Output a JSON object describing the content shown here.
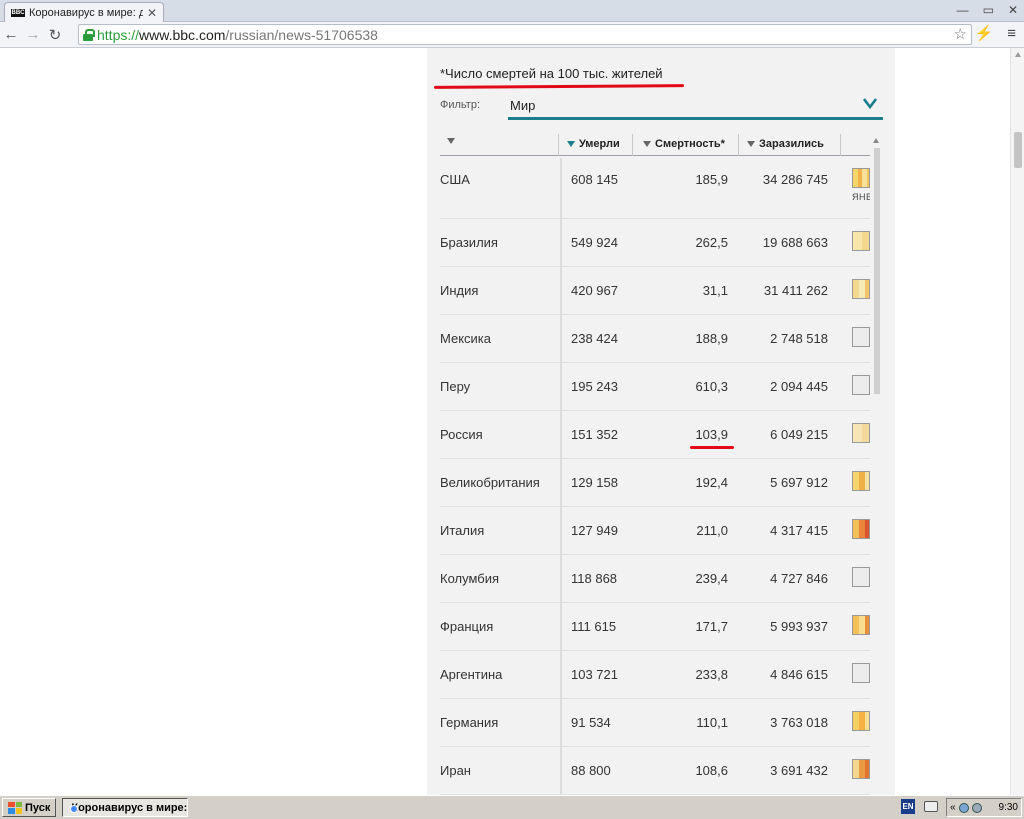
{
  "browser": {
    "tab_title": "Коронавирус в мире: данн",
    "tab_favicon_text": "BBC",
    "url_scheme": "https://",
    "url_host": "www.bbc.com",
    "url_path": "/russian/news-51706538"
  },
  "page": {
    "note": "*Число смертей на 100 тыс. жителей",
    "filter_label": "Фильтр:",
    "filter_value": "Мир"
  },
  "table": {
    "headers": {
      "country": "",
      "deaths": "Умерли",
      "rate": "Смертность*",
      "cases": "Заразились"
    },
    "rows": [
      {
        "country": "США",
        "deaths": "608 145",
        "rate": "185,9",
        "cases": "34 286 745"
      },
      {
        "country": "Бразилия",
        "deaths": "549 924",
        "rate": "262,5",
        "cases": "19 688 663"
      },
      {
        "country": "Индия",
        "deaths": "420 967",
        "rate": "31,1",
        "cases": "31 411 262"
      },
      {
        "country": "Мексика",
        "deaths": "238 424",
        "rate": "188,9",
        "cases": "2 748 518"
      },
      {
        "country": "Перу",
        "deaths": "195 243",
        "rate": "610,3",
        "cases": "2 094 445"
      },
      {
        "country": "Россия",
        "deaths": "151 352",
        "rate": "103,9",
        "cases": "6 049 215"
      },
      {
        "country": "Великобритания",
        "deaths": "129 158",
        "rate": "192,4",
        "cases": "5 697 912"
      },
      {
        "country": "Италия",
        "deaths": "127 949",
        "rate": "211,0",
        "cases": "4 317 415"
      },
      {
        "country": "Колумбия",
        "deaths": "118 868",
        "rate": "239,4",
        "cases": "4 727 846"
      },
      {
        "country": "Франция",
        "deaths": "111 615",
        "rate": "171,7",
        "cases": "5 993 937"
      },
      {
        "country": "Аргентина",
        "deaths": "103 721",
        "rate": "233,8",
        "cases": "4 846 615"
      },
      {
        "country": "Германия",
        "deaths": "91 534",
        "rate": "110,1",
        "cases": "3 763 018"
      },
      {
        "country": "Иран",
        "deaths": "88 800",
        "rate": "108,6",
        "cases": "3 691 432"
      }
    ],
    "first_row_month_label": "ЯНВ"
  },
  "taskbar": {
    "start_label": "Пуск",
    "task_label": "Коронавирус в мире: ...",
    "lang": "EN",
    "time": "9:30"
  },
  "colors": {
    "accent": "#1c7d8c",
    "highlight": "#e10b17",
    "panel_bg": "#f2f2f2"
  }
}
